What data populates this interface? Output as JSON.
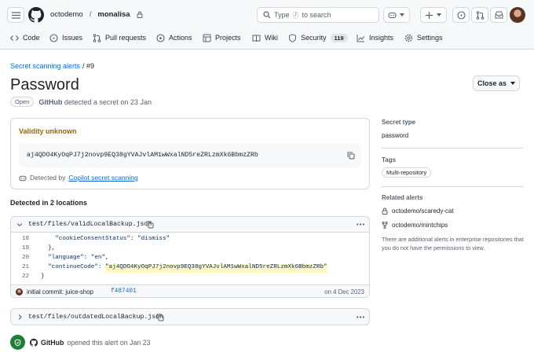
{
  "header": {
    "org": "octodemo",
    "separator": "/",
    "repo": "monalisa",
    "search_prefix": "Type",
    "search_key": "/",
    "search_suffix": "to search"
  },
  "tabs": [
    {
      "label": "Code",
      "icon": "code-icon"
    },
    {
      "label": "Issues",
      "icon": "issue-icon"
    },
    {
      "label": "Pull requests",
      "icon": "pull-request-icon"
    },
    {
      "label": "Actions",
      "icon": "play-icon"
    },
    {
      "label": "Projects",
      "icon": "table-icon"
    },
    {
      "label": "Wiki",
      "icon": "book-icon"
    },
    {
      "label": "Security",
      "icon": "shield-icon",
      "count": "119"
    },
    {
      "label": "Insights",
      "icon": "graph-icon"
    },
    {
      "label": "Settings",
      "icon": "gear-icon"
    }
  ],
  "breadcrumb": {
    "link": "Secret scanning alerts",
    "current": "/ #9"
  },
  "title": "Password",
  "close_button": "Close as",
  "status": {
    "badge": "Open",
    "author": "GitHub",
    "text": "detected a secret on 23 Jan"
  },
  "validity": {
    "label": "Validity unknown",
    "secret": "aj4QDO4KyOqPJ7j2novp9EQ38gYVAJvlAM1wWxalND5reZRLzmXk6BbmzZRb",
    "detected_by_prefix": "Detected by",
    "detected_by_link": "Copilot secret scanning"
  },
  "locations": {
    "heading": "Detected in 2 locations",
    "file1": "test/files/validLocalBackup.json",
    "code": [
      {
        "num": "18",
        "text": "    \"cookieConsentStatus\": \"dismiss\""
      },
      {
        "num": "19",
        "text": "  },"
      },
      {
        "num": "20",
        "text": "  \"language\": \"en\","
      },
      {
        "num": "21",
        "key": "  \"continueCode\": ",
        "value": "\"aj4QDO4KyOqPJ7j2novp9EQ38gYVAJvlAM1wWxalND5reZRLzmXk6BbmzZRb\""
      },
      {
        "num": "22",
        "text": "}"
      }
    ],
    "commit_message": "initial commit: juice-shop",
    "commit_sha": "f487401",
    "commit_date": "on 4 Dec 2023",
    "file2": "test/files/outdatedLocalBackup.json"
  },
  "timeline": {
    "author": "GitHub",
    "text": "opened this alert on Jan 23"
  },
  "sidebar": {
    "secret_type_heading": "Secret type",
    "secret_type": "password",
    "tags_heading": "Tags",
    "tag": "Multi-repository",
    "related_heading": "Related alerts",
    "related": [
      "octodemo/scaredy-cat",
      "octodemo/mintchips"
    ],
    "note": "There are additional alerts in enterprise repositories that you do not have the permissions to view."
  },
  "colors": {
    "accent": "#0969da",
    "warning": "#9a6700",
    "success": "#1a7f37",
    "highlight": "#fff8c5"
  }
}
